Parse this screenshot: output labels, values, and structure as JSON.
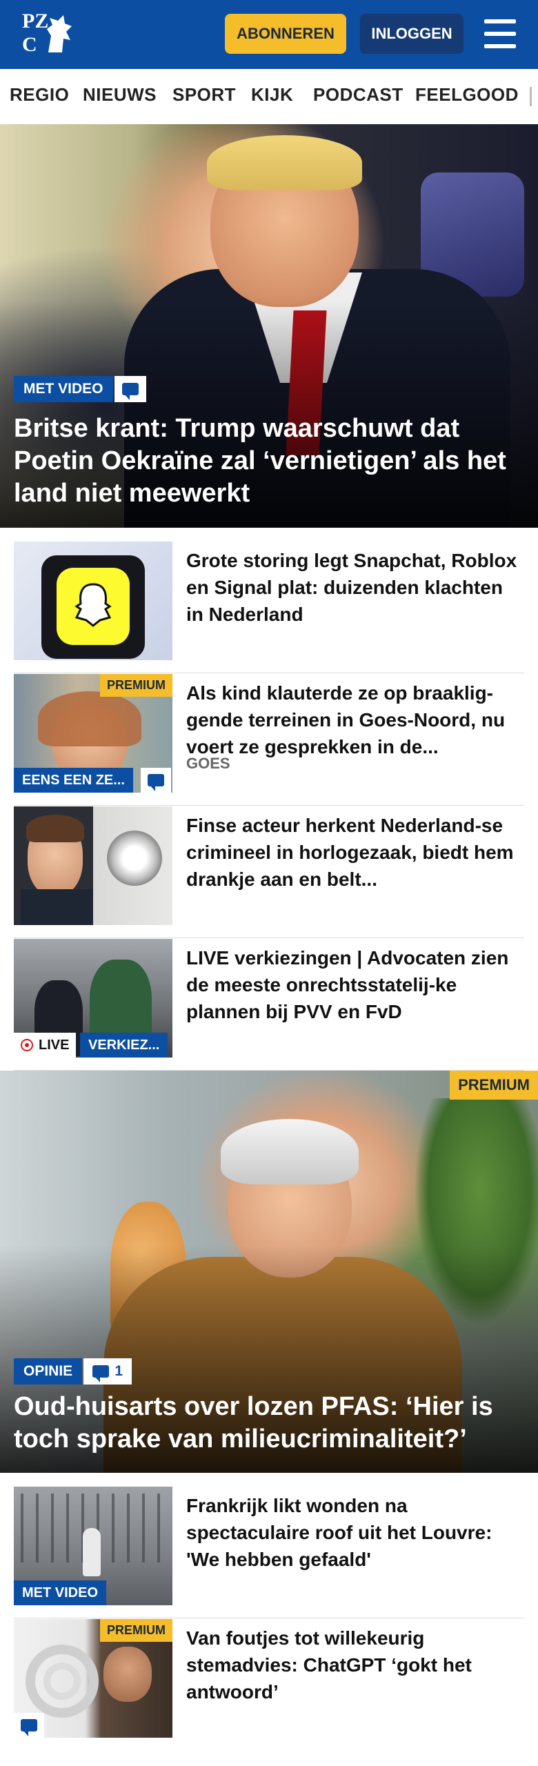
{
  "header": {
    "logo_line1": "PZ",
    "logo_line2": "C",
    "subscribe_label": "ABONNEREN",
    "login_label": "INLOGGEN",
    "menu_icon": "hamburger-menu-icon",
    "brand_color": "#0b4ea2",
    "accent_color": "#f6bd2a"
  },
  "nav": {
    "items": [
      "REGIO",
      "NIEUWS",
      "SPORT",
      "KIJK",
      "PODCAST",
      "FEELGOOD"
    ]
  },
  "hero1": {
    "tag": "MET VIDEO",
    "comment_icon": "comment-icon",
    "title": "Britse krant: Trump waarschuwt dat Poetin Oekraïne zal ‘vernietigen’ als het land niet meewerkt"
  },
  "articles1": [
    {
      "title": "Grote storing legt Snapchat, Roblox en Signal plat: duizenden klachten in Nederland"
    },
    {
      "title": "Als kind klauterde ze op braaklig-gende terreinen in Goes-Noord, nu voert ze gesprekken in de...",
      "premium": "PREMIUM",
      "tag": "EENS EEN ZE...",
      "location": "GOES"
    },
    {
      "title": "Finse acteur herkent Nederland-se crimineel in horlogezaak, biedt hem drankje aan en belt..."
    },
    {
      "title": "LIVE verkiezingen | Advocaten zien de meeste onrechtsstatelij-ke plannen bij PVV en FvD",
      "live": "LIVE",
      "tag": "VERKIEZ..."
    }
  ],
  "hero2": {
    "premium": "PREMIUM",
    "tag": "OPINIE",
    "comment_count": "1",
    "title": "Oud-huisarts over lozen PFAS: ‘Hier is toch sprake van milieucriminaliteit?’"
  },
  "articles2": [
    {
      "title": "Frankrijk likt wonden na spectaculaire roof uit het Louvre: 'We hebben gefaald'",
      "tag": "MET VIDEO"
    },
    {
      "title": "Van foutjes tot willekeurig stemadvies: ChatGPT ‘gokt het antwoord’",
      "premium": "PREMIUM"
    }
  ]
}
